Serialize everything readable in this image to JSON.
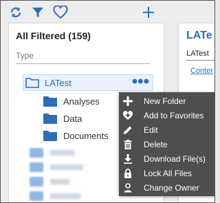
{
  "toolbar": {
    "icons": [
      "refresh-icon",
      "filter-icon",
      "favorite-icon",
      "add-icon"
    ],
    "accent": "#2f6eb5"
  },
  "left_panel": {
    "title": "All Filtered (159)",
    "filter_label": "Type",
    "selected_item": "LATest",
    "children": [
      "Analyses",
      "Data",
      "Documents"
    ]
  },
  "right_panel": {
    "title": "LATe",
    "subtitle": "LATest",
    "tab": "Conter"
  },
  "context_menu": {
    "items": [
      {
        "label": "New Folder",
        "icon": "plus-icon"
      },
      {
        "label": "Add to Favorites",
        "icon": "heart-plus-icon"
      },
      {
        "label": "Edit",
        "icon": "pencil-icon"
      },
      {
        "label": "Delete",
        "icon": "trash-icon"
      },
      {
        "label": "Download File(s)",
        "icon": "download-icon"
      },
      {
        "label": "Lock All Files",
        "icon": "lock-icon"
      },
      {
        "label": "Change Owner",
        "icon": "user-icon"
      }
    ]
  }
}
